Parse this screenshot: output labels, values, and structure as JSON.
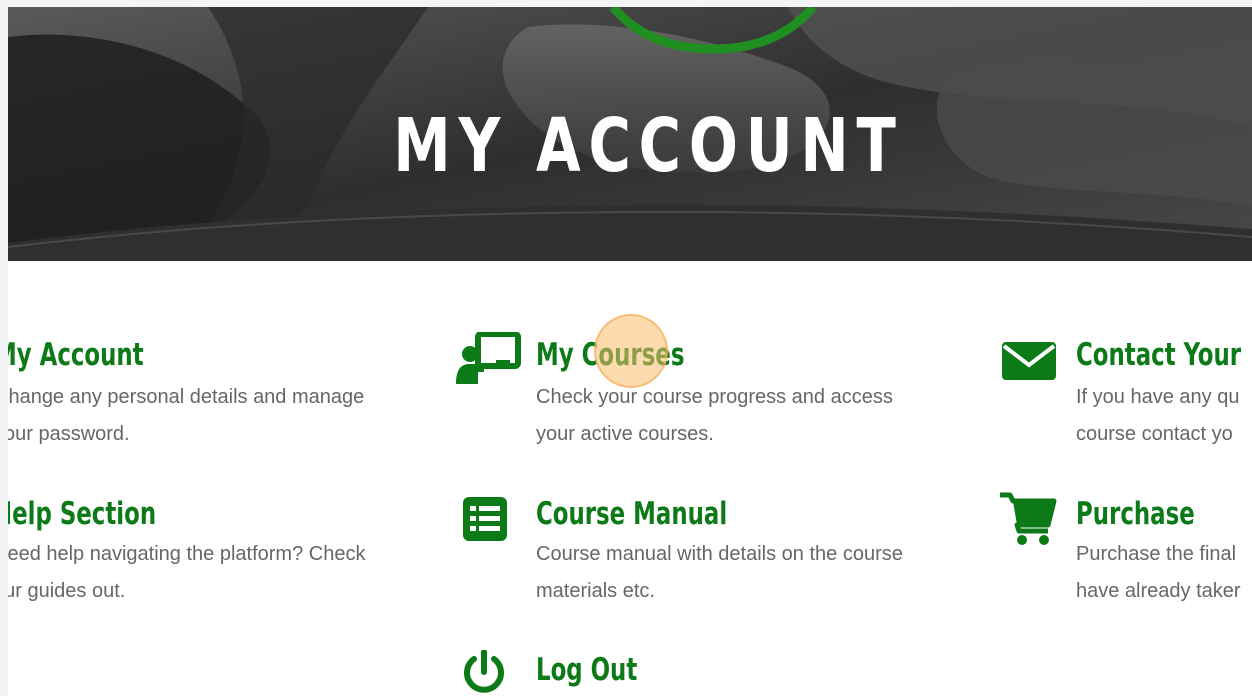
{
  "hero": {
    "title": "MY ACCOUNT"
  },
  "cards": {
    "my_account": {
      "title": "My Account",
      "desc_line1": "Change any personal details and manage",
      "desc_line2": "your password."
    },
    "my_courses": {
      "title": "My Courses",
      "icon": "teacher-board-icon",
      "desc_line1": "Check your course progress and access",
      "desc_line2": "your active courses."
    },
    "contact": {
      "title": "Contact Your",
      "icon": "envelope-icon",
      "desc_line1": "If you have any qu",
      "desc_line2": "course contact yo"
    },
    "help": {
      "title": "Help Section",
      "desc_line1": "Need help navigating the platform? Check",
      "desc_line2": "our guides out."
    },
    "course_manual": {
      "title": "Course Manual",
      "icon": "list-icon",
      "desc_line1": "Course manual with details on the course",
      "desc_line2": "materials etc."
    },
    "purchase": {
      "title": "Purchase",
      "icon": "shopping-cart-icon",
      "desc_line1": "Purchase the final",
      "desc_line2": "have already taker"
    },
    "log_out": {
      "title": "Log Out",
      "icon": "power-icon"
    }
  },
  "colors": {
    "accent": "#0b7a17",
    "text": "#666666",
    "hero_overlay": "#3a3a3a",
    "click_marker": "#fabe6e"
  }
}
